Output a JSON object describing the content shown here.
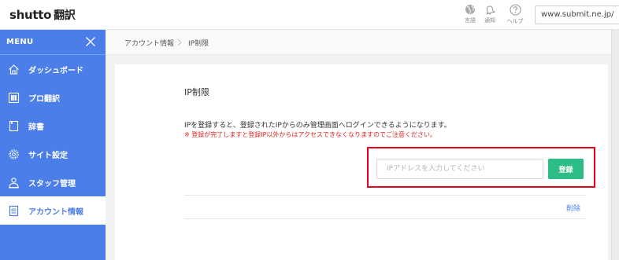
{
  "header": {
    "logo_text": "shutto",
    "logo_jp": "翻訳",
    "icons": [
      {
        "name": "globe-icon",
        "label": "言語"
      },
      {
        "name": "bell-icon",
        "label": "通知"
      },
      {
        "name": "help-icon",
        "label": "ヘルプ"
      }
    ],
    "url": "www.submit.ne.jp/"
  },
  "sidebar": {
    "menu_title": "MENU",
    "items": [
      {
        "label": "ダッシュボード",
        "icon": "home-icon",
        "active": false
      },
      {
        "label": "プロ翻訳",
        "icon": "grid-icon",
        "active": false
      },
      {
        "label": "辞書",
        "icon": "book-icon",
        "active": false
      },
      {
        "label": "サイト設定",
        "icon": "gear-icon",
        "active": false
      },
      {
        "label": "スタッフ管理",
        "icon": "staff-icon",
        "active": false
      },
      {
        "label": "アカウント情報",
        "icon": "document-icon",
        "active": true
      }
    ]
  },
  "breadcrumb": {
    "items": [
      "アカウント情報",
      "IP制限"
    ]
  },
  "main": {
    "title": "IP制限",
    "description": "IPを登録すると、登録されたIPからのみ管理画面へログインできるようになります。",
    "warning": "※ 登録が完了しますと登録IP以外からはアクセスできなくなりますのでご注意ください。",
    "input_placeholder": "IPアドレスを入力してください",
    "input_value": "",
    "register_button": "登録",
    "delete_link": "削除"
  },
  "colors": {
    "sidebar": "#4b7ee8",
    "button": "#2ebc86",
    "warning": "#e02020",
    "highlight": "#e8001c"
  }
}
